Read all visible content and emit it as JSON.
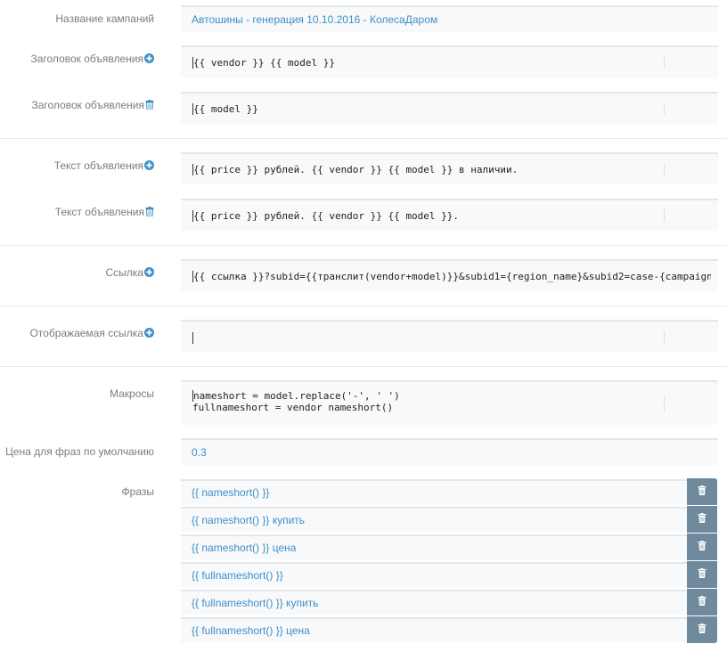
{
  "form": {
    "campaign_name": {
      "label": "Название кампаний",
      "value": "Автошины - генерация 10.10.2016 - КолесаДаром"
    },
    "headlines": [
      {
        "label": "Заголовок объявления",
        "value": "{{ vendor }} {{ model }}",
        "icon": "plus-circle-icon"
      },
      {
        "label": "Заголовок объявления",
        "value": "{{ model }}",
        "icon": "trash-icon"
      }
    ],
    "texts": [
      {
        "label": "Текст объявления",
        "value": "{{ price }} рублей. {{ vendor }} {{ model }} в наличии.",
        "icon": "plus-circle-icon"
      },
      {
        "label": "Текст объявления",
        "value": "{{ price }} рублей. {{ vendor }} {{ model }}.",
        "icon": "trash-icon"
      }
    ],
    "link": {
      "label": "Ссылка",
      "value": "{{ ссылка }}?subid={{транслит(vendor+model)}}&subid1={region_name}&subid2=case-{campaign"
    },
    "display_link": {
      "label": "Отображаемая ссылка",
      "value": ""
    },
    "macros": {
      "label": "Макросы",
      "line1": "nameshort = model.replace('-', ' ')",
      "line2": "fullnameshort = vendor nameshort()"
    },
    "default_price": {
      "label": "Цена для фраз по умолчанию",
      "value": "0.3"
    },
    "phrases": {
      "label": "Фразы",
      "items": [
        "{{ nameshort() }}",
        "{{ nameshort() }} купить",
        "{{ nameshort() }} цена",
        "{{ fullnameshort() }}",
        "{{ fullnameshort() }} купить",
        "{{ fullnameshort() }} цена"
      ]
    }
  },
  "colors": {
    "label": "#7c7c7c",
    "value_link": "#3d8ec8",
    "icon_blue": "#3d8ec8",
    "delete_button": "#6e8a9c",
    "field_bg": "#f8f9fa"
  }
}
